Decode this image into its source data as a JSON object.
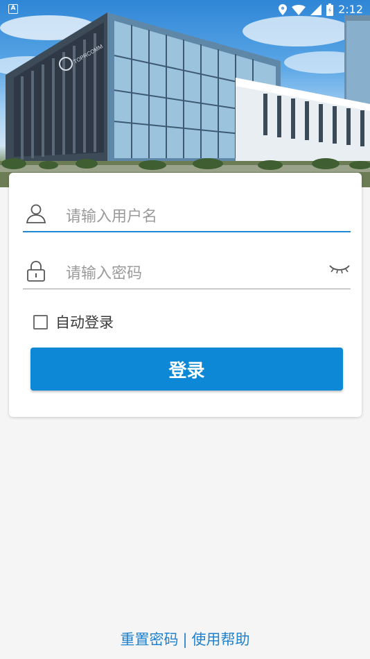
{
  "status_bar": {
    "notification_icon": "a-icon",
    "time": "2:12",
    "icons": [
      "location-icon",
      "wifi-icon",
      "signal-icon",
      "battery-icon"
    ]
  },
  "hero": {
    "building_sign": "TOPRCOMM"
  },
  "login": {
    "username_placeholder": "请输入用户名",
    "password_placeholder": "请输入密码",
    "remember_label": "自动登录",
    "submit_label": "登录"
  },
  "footer": {
    "reset_password": "重置密码",
    "separator": "|",
    "help": "使用帮助"
  },
  "colors": {
    "accent": "#0c88d6",
    "link": "#1e82cf",
    "background": "#f5f5f5"
  }
}
